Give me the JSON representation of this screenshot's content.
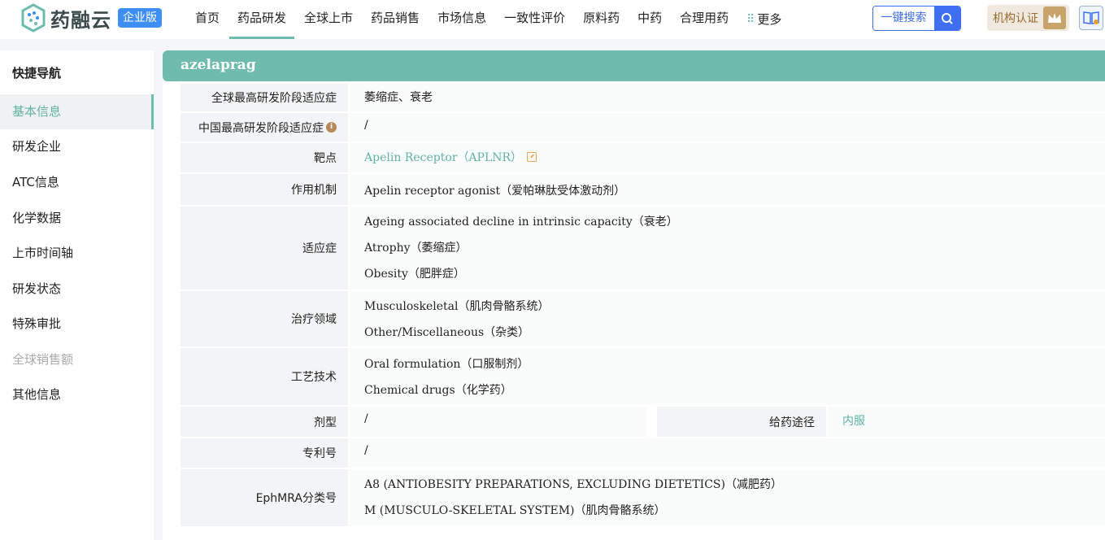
{
  "header": {
    "logo_text": "药融云",
    "logo_badge": "企业版",
    "nav": [
      "首页",
      "药品研发",
      "全球上市",
      "药品销售",
      "市场信息",
      "一致性评价",
      "原料药",
      "中药",
      "合理用药"
    ],
    "nav_more": "更多",
    "search_label": "一键搜索",
    "cert_label": "机构认证"
  },
  "sidebar": {
    "title": "快捷导航",
    "items": [
      "基本信息",
      "研发企业",
      "ATC信息",
      "化学数据",
      "上市时间轴",
      "研发状态",
      "特殊审批",
      "全球销售额",
      "其他信息"
    ]
  },
  "drug": {
    "name": "azelaprag",
    "rows": {
      "global_indication": {
        "label": "全球最高研发阶段适应症",
        "value": "萎缩症、衰老"
      },
      "china_indication": {
        "label": "中国最高研发阶段适应症",
        "value": "/"
      },
      "target": {
        "label": "靶点",
        "value": "Apelin Receptor（APLNR）"
      },
      "mechanism": {
        "label": "作用机制",
        "value": "Apelin receptor agonist（爱帕琳肽受体激动剂）"
      },
      "indications": {
        "label": "适应症",
        "values": [
          "Ageing associated decline in intrinsic capacity（衰老）",
          "Atrophy（萎缩症）",
          "Obesity（肥胖症）"
        ]
      },
      "therapeutic_area": {
        "label": "治疗领域",
        "values": [
          "Musculoskeletal（肌肉骨骼系统）",
          "Other/Miscellaneous（杂类）"
        ]
      },
      "technology": {
        "label": "工艺技术",
        "values": [
          "Oral formulation（口服制剂）",
          "Chemical drugs（化学药）"
        ]
      },
      "dosage_form": {
        "label": "剂型",
        "value": "/"
      },
      "route": {
        "label": "给药途径",
        "value": "内服"
      },
      "patent": {
        "label": "专利号",
        "value": "/"
      },
      "ephmra": {
        "label": "EphMRA分类号",
        "values": [
          "A8 (ANTIOBESITY PREPARATIONS, EXCLUDING DIETETICS)（减肥药）",
          "M (MUSCULO-SKELETAL SYSTEM)（肌肉骨骼系统）"
        ]
      }
    }
  }
}
